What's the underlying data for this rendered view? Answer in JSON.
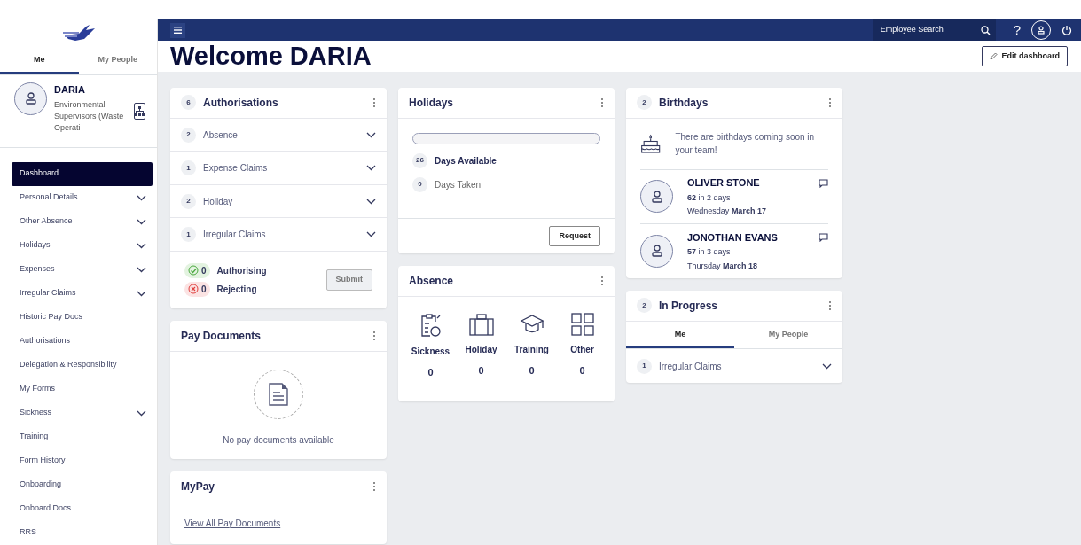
{
  "sidebar": {
    "tabs": [
      {
        "label": "Me",
        "selected": true
      },
      {
        "label": "My People",
        "selected": false
      }
    ],
    "profile": {
      "name": "DARIA",
      "role": "Environmental Supervisors (Waste Operati"
    },
    "items": [
      {
        "label": "Dashboard",
        "selected": true,
        "expandable": false
      },
      {
        "label": "Personal Details",
        "selected": false,
        "expandable": true
      },
      {
        "label": "Other Absence",
        "selected": false,
        "expandable": true
      },
      {
        "label": "Holidays",
        "selected": false,
        "expandable": true
      },
      {
        "label": "Expenses",
        "selected": false,
        "expandable": true
      },
      {
        "label": "Irregular Claims",
        "selected": false,
        "expandable": true
      },
      {
        "label": "Historic Pay Docs",
        "selected": false,
        "expandable": false
      },
      {
        "label": "Authorisations",
        "selected": false,
        "expandable": false
      },
      {
        "label": "Delegation & Responsibility",
        "selected": false,
        "expandable": false
      },
      {
        "label": "My Forms",
        "selected": false,
        "expandable": false
      },
      {
        "label": "Sickness",
        "selected": false,
        "expandable": true
      },
      {
        "label": "Training",
        "selected": false,
        "expandable": false
      },
      {
        "label": "Form History",
        "selected": false,
        "expandable": false
      },
      {
        "label": "Onboarding",
        "selected": false,
        "expandable": false
      },
      {
        "label": "Onboard Docs",
        "selected": false,
        "expandable": false
      },
      {
        "label": "RRS",
        "selected": false,
        "expandable": false
      }
    ]
  },
  "topbar": {
    "search": {
      "placeholder": "Employee Search"
    },
    "help": "?"
  },
  "header": {
    "title": "Welcome DARIA",
    "edit_button": "Edit dashboard"
  },
  "authorisations": {
    "count": "6",
    "title": "Authorisations",
    "rows": [
      {
        "count": "2",
        "label": "Absence"
      },
      {
        "count": "1",
        "label": "Expense Claims"
      },
      {
        "count": "2",
        "label": "Holiday"
      },
      {
        "count": "1",
        "label": "Irregular Claims"
      }
    ],
    "tallies": [
      {
        "kind": "authorising",
        "count": "0",
        "label": "Authorising"
      },
      {
        "kind": "rejecting",
        "count": "0",
        "label": "Rejecting"
      }
    ],
    "submit": {
      "label": "Submit",
      "disabled": true
    }
  },
  "pay_documents": {
    "title": "Pay Documents",
    "empty": "No pay documents available"
  },
  "mypay": {
    "title": "MyPay",
    "link": "View All Pay Documents"
  },
  "holidays": {
    "title": "Holidays",
    "level": 0,
    "available": {
      "count": "26",
      "label": "Days Available"
    },
    "taken": {
      "count": "0",
      "label": "Days Taken"
    },
    "button": "Request"
  },
  "absence": {
    "title": "Absence",
    "categories": [
      {
        "kind": "sickness",
        "label": "Sickness",
        "count": "0"
      },
      {
        "kind": "holiday",
        "label": "Holiday",
        "count": "0"
      },
      {
        "kind": "training",
        "label": "Training",
        "count": "0"
      },
      {
        "kind": "other",
        "label": "Other",
        "count": "0"
      }
    ]
  },
  "birthdays": {
    "count": "2",
    "title": "Birthdays",
    "message": "There are birthdays coming soon in your team!",
    "people": [
      {
        "name": "OLIVER STONE",
        "age": "**62** in 2 days",
        "date": "Wednesday **March 17**"
      },
      {
        "name": "JONOTHAN EVANS",
        "age": "**57** in 3 days",
        "date": "Thursday **March 18**"
      }
    ]
  },
  "in_progress": {
    "count": "2",
    "title": "In Progress",
    "tabs": [
      {
        "label": "Me",
        "selected": true
      },
      {
        "label": "My People",
        "selected": false
      }
    ],
    "rows": [
      {
        "count": "1",
        "label": "Irregular Claims"
      }
    ]
  }
}
